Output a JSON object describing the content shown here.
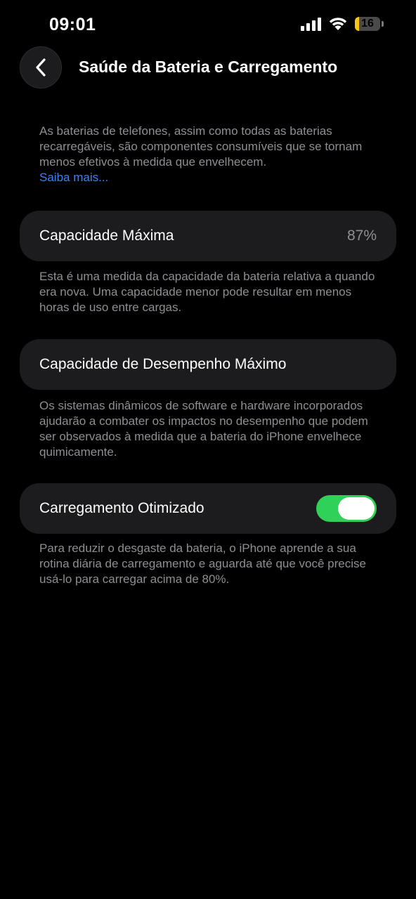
{
  "status_bar": {
    "time": "09:01",
    "battery_level": "16",
    "battery_fraction": 0.16,
    "signal_icon": "cellular-signal-icon",
    "wifi_icon": "wifi-icon"
  },
  "header": {
    "back_icon": "chevron-left-icon",
    "title": "Saúde da Bateria e Carregamento"
  },
  "intro": {
    "text": "As baterias de telefones, assim como todas as baterias recarregáveis, são componentes consumíveis que se tornam menos efetivos à medida que envelhecem.",
    "link": "Saiba mais..."
  },
  "max_capacity": {
    "label": "Capacidade Máxima",
    "value": "87%",
    "footnote": "Esta é uma medida da capacidade da bateria relativa a quando era nova. Uma capacidade menor pode resultar em menos horas de uso entre cargas."
  },
  "peak_performance": {
    "label": "Capacidade de Desempenho Máximo",
    "footnote": "Os sistemas dinâmicos de software e hardware incorporados ajudarão a combater os impactos no desempenho que podem ser observados à medida que a bateria do iPhone envelhece quimicamente."
  },
  "optimized_charging": {
    "label": "Carregamento Otimizado",
    "enabled": true,
    "footnote": "Para reduzir o desgaste da bateria, o iPhone aprende a sua rotina diária de carregamento e aguarda até que você precise usá-lo para carregar acima de 80%."
  },
  "colors": {
    "background": "#000000",
    "card": "#1c1c1e",
    "secondary_text": "#8e8e93",
    "link": "#3b82f6",
    "toggle_on": "#30d158",
    "battery_low": "#f5c518"
  }
}
